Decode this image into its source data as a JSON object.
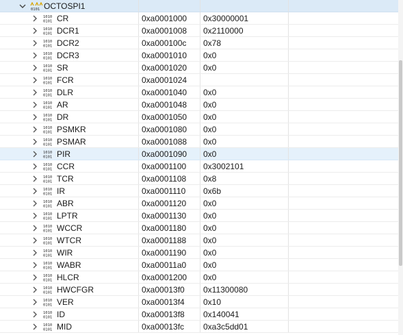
{
  "peripheral": {
    "name": "OCTOSPI1",
    "address": "",
    "value": ""
  },
  "selected_register": "PIR",
  "registers": [
    {
      "name": "CR",
      "address": "0xa0001000",
      "value": "0x30000001"
    },
    {
      "name": "DCR1",
      "address": "0xa0001008",
      "value": "0x2110000"
    },
    {
      "name": "DCR2",
      "address": "0xa000100c",
      "value": "0x78"
    },
    {
      "name": "DCR3",
      "address": "0xa0001010",
      "value": "0x0"
    },
    {
      "name": "SR",
      "address": "0xa0001020",
      "value": "0x0"
    },
    {
      "name": "FCR",
      "address": "0xa0001024",
      "value": ""
    },
    {
      "name": "DLR",
      "address": "0xa0001040",
      "value": "0x0"
    },
    {
      "name": "AR",
      "address": "0xa0001048",
      "value": "0x0"
    },
    {
      "name": "DR",
      "address": "0xa0001050",
      "value": "0x0"
    },
    {
      "name": "PSMKR",
      "address": "0xa0001080",
      "value": "0x0"
    },
    {
      "name": "PSMAR",
      "address": "0xa0001088",
      "value": "0x0"
    },
    {
      "name": "PIR",
      "address": "0xa0001090",
      "value": "0x0"
    },
    {
      "name": "CCR",
      "address": "0xa0001100",
      "value": "0x3002101"
    },
    {
      "name": "TCR",
      "address": "0xa0001108",
      "value": "0x8"
    },
    {
      "name": "IR",
      "address": "0xa0001110",
      "value": "0x6b"
    },
    {
      "name": "ABR",
      "address": "0xa0001120",
      "value": "0x0"
    },
    {
      "name": "LPTR",
      "address": "0xa0001130",
      "value": "0x0"
    },
    {
      "name": "WCCR",
      "address": "0xa0001180",
      "value": "0x0"
    },
    {
      "name": "WTCR",
      "address": "0xa0001188",
      "value": "0x0"
    },
    {
      "name": "WIR",
      "address": "0xa0001190",
      "value": "0x0"
    },
    {
      "name": "WABR",
      "address": "0xa00011a0",
      "value": "0x0"
    },
    {
      "name": "HLCR",
      "address": "0xa0001200",
      "value": "0x0"
    },
    {
      "name": "HWCFGR",
      "address": "0xa00013f0",
      "value": "0x11300080"
    },
    {
      "name": "VER",
      "address": "0xa00013f4",
      "value": "0x10"
    },
    {
      "name": "ID",
      "address": "0xa00013f8",
      "value": "0x140041"
    },
    {
      "name": "MID",
      "address": "0xa00013fc",
      "value": "0xa3c5dd01"
    }
  ],
  "icons": {
    "group_expander": "chevron-down-icon",
    "register_expander": "chevron-right-icon",
    "peripheral_icon": "peripheral-binary-icon",
    "register_icon": "binary-register-icon"
  },
  "colors": {
    "group_row": "#dbeaf7",
    "selected_row": "#e5f1fb",
    "text": "#1a1a1a",
    "icon": "#2b2b2b",
    "peripheral_icon_accent": "#d9a400"
  }
}
